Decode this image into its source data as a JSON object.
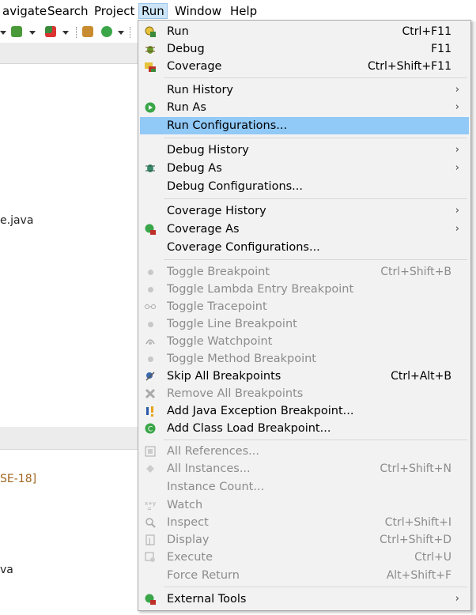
{
  "menubar": {
    "items": [
      "avigate",
      "Search",
      "Project",
      "Run",
      "Window",
      "Help"
    ]
  },
  "background": {
    "file1": "e.java",
    "jre": "SE-18]",
    "file2": "va"
  },
  "menu": {
    "run": {
      "label": "Run",
      "shortcut": "Ctrl+F11"
    },
    "debug": {
      "label": "Debug",
      "shortcut": "F11"
    },
    "coverage": {
      "label": "Coverage",
      "shortcut": "Ctrl+Shift+F11"
    },
    "run_history": {
      "label": "Run History",
      "arrow": "›"
    },
    "run_as": {
      "label": "Run As",
      "arrow": "›"
    },
    "run_configurations": {
      "label": "Run Configurations..."
    },
    "debug_history": {
      "label": "Debug History",
      "arrow": "›"
    },
    "debug_as": {
      "label": "Debug As",
      "arrow": "›"
    },
    "debug_configurations": {
      "label": "Debug Configurations..."
    },
    "coverage_history": {
      "label": "Coverage History",
      "arrow": "›"
    },
    "coverage_as": {
      "label": "Coverage As",
      "arrow": "›"
    },
    "coverage_configurations": {
      "label": "Coverage Configurations..."
    },
    "toggle_breakpoint": {
      "label": "Toggle Breakpoint",
      "shortcut": "Ctrl+Shift+B"
    },
    "toggle_lambda": {
      "label": "Toggle Lambda Entry Breakpoint"
    },
    "toggle_tracepoint": {
      "label": "Toggle Tracepoint"
    },
    "toggle_line": {
      "label": "Toggle Line Breakpoint"
    },
    "toggle_watchpoint": {
      "label": "Toggle Watchpoint"
    },
    "toggle_method": {
      "label": "Toggle Method Breakpoint"
    },
    "skip_all": {
      "label": "Skip All Breakpoints",
      "shortcut": "Ctrl+Alt+B"
    },
    "remove_all": {
      "label": "Remove All Breakpoints"
    },
    "add_java_exception": {
      "label": "Add Java Exception Breakpoint..."
    },
    "add_class_load": {
      "label": "Add Class Load Breakpoint..."
    },
    "all_references": {
      "label": "All References..."
    },
    "all_instances": {
      "label": "All Instances...",
      "shortcut": "Ctrl+Shift+N"
    },
    "instance_count": {
      "label": "Instance Count..."
    },
    "watch": {
      "label": "Watch"
    },
    "inspect": {
      "label": "Inspect",
      "shortcut": "Ctrl+Shift+I"
    },
    "display": {
      "label": "Display",
      "shortcut": "Ctrl+Shift+D"
    },
    "execute": {
      "label": "Execute",
      "shortcut": "Ctrl+U"
    },
    "force_return": {
      "label": "Force Return",
      "shortcut": "Alt+Shift+F"
    },
    "external_tools": {
      "label": "External Tools",
      "arrow": "›"
    }
  },
  "colors": {
    "highlight": "#91c9f7",
    "menu_bg": "#f2f2f2",
    "disabled_text": "#8c8c8c"
  }
}
